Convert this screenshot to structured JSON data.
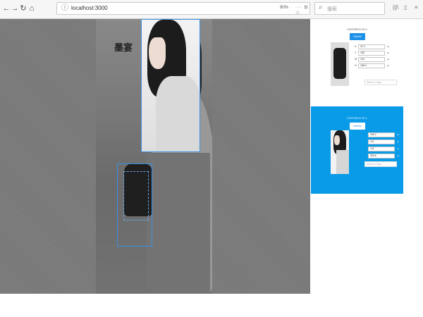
{
  "browser": {
    "url": "localhost:3000",
    "zoom": "90%",
    "search_placeholder": "搜索",
    "icons": [
      "back-icon",
      "forward-icon",
      "reload-icon",
      "home-icon",
      "info-icon",
      "more-icon",
      "pocket-icon",
      "bookmark-icon",
      "search-icon",
      "library-icon",
      "sidebar-icon",
      "menu-icon"
    ]
  },
  "canvas": {
    "logo_text": "墨宴"
  },
  "panel": {
    "cards": [
      {
        "title": "CROPBOX ID:2",
        "delete_label": "Delete",
        "fields": [
          {
            "label": "X",
            "value": "91.2",
            "unit": "px"
          },
          {
            "label": "Y",
            "value": "156",
            "unit": "px"
          },
          {
            "label": "W",
            "value": "144",
            "unit": "px"
          },
          {
            "label": "H",
            "value": "156.4",
            "unit": "px"
          }
        ],
        "tags_placeholder": "Select a Tags"
      },
      {
        "title": "CROPBOX ID:1",
        "delete_label": "Delete",
        "fields": [
          {
            "label": "",
            "value": "184.2",
            "unit": "px"
          },
          {
            "label": "",
            "value": "4.8",
            "unit": "px"
          },
          {
            "label": "",
            "value": "122",
            "unit": "px"
          },
          {
            "label": "",
            "value": "303.6",
            "unit": "px"
          }
        ],
        "tags_placeholder": "Select a Tags"
      }
    ]
  },
  "colors": {
    "accent": "#1e90e8",
    "active_card": "#0a9be8",
    "crop_border": "#3b8fe0"
  }
}
